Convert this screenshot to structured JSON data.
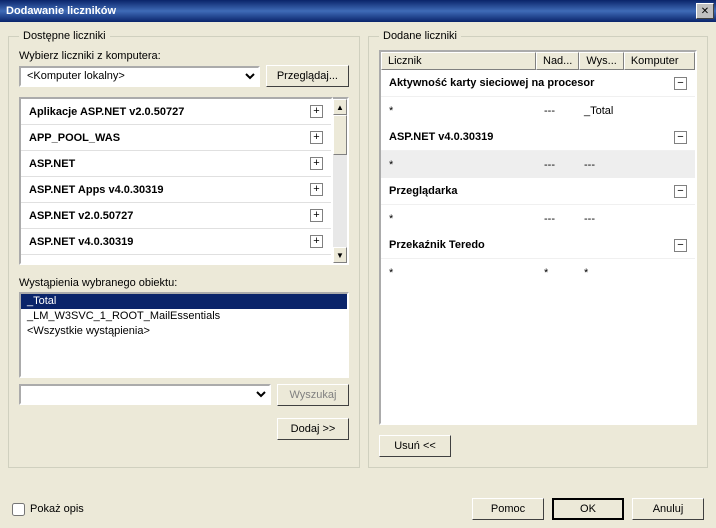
{
  "title": "Dodawanie liczników",
  "close_x": "✕",
  "left": {
    "legend": "Dostępne liczniki",
    "computer_label": "Wybierz liczniki z komputera:",
    "computer_value": "<Komputer lokalny>",
    "browse": "Przeglądaj...",
    "objects": [
      "Aplikacje ASP.NET v2.0.50727",
      "APP_POOL_WAS",
      "ASP.NET",
      "ASP.NET Apps v4.0.30319",
      "ASP.NET v2.0.50727",
      "ASP.NET v4.0.30319"
    ],
    "instances_label": "Wystąpienia wybranego obiektu:",
    "instances": [
      "_Total",
      "_LM_W3SVC_1_ROOT_MailEssentials",
      "<Wszystkie wystąpienia>"
    ],
    "instance_selected": 0,
    "search": "Wyszukaj",
    "add": "Dodaj >>"
  },
  "right": {
    "legend": "Dodane liczniki",
    "headers": {
      "c1": "Licznik",
      "c2": "Nad...",
      "c3": "Wys...",
      "c4": "Komputer"
    },
    "groups": [
      {
        "name": "Aktywność karty sieciowej na procesor",
        "rows": [
          {
            "c1": "*",
            "c2": "---",
            "c3": "_Total",
            "zebra": false
          }
        ]
      },
      {
        "name": "ASP.NET v4.0.30319",
        "rows": [
          {
            "c1": "*",
            "c2": "---",
            "c3": "---",
            "zebra": true
          }
        ]
      },
      {
        "name": "Przeglądarka",
        "rows": [
          {
            "c1": "*",
            "c2": "---",
            "c3": "---",
            "zebra": false
          }
        ]
      },
      {
        "name": "Przekaźnik Teredo",
        "rows": [
          {
            "c1": "*",
            "c2": "*",
            "c3": "*",
            "zebra": false
          }
        ]
      }
    ],
    "remove": "Usuń <<"
  },
  "bottom": {
    "show_desc": "Pokaż opis",
    "help": "Pomoc",
    "ok": "OK",
    "cancel": "Anuluj"
  }
}
